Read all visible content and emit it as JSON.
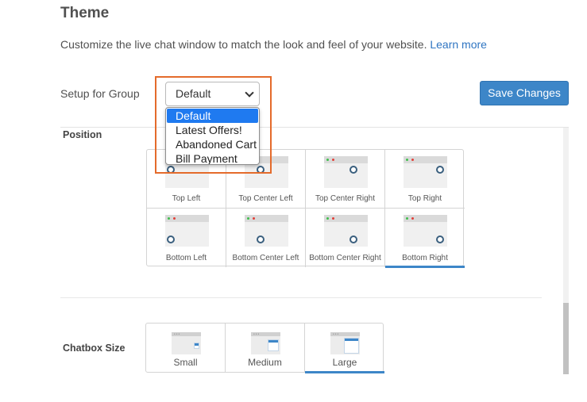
{
  "page": {
    "title": "Theme",
    "description": "Customize the live chat window to match the look and feel of your website.",
    "learn_more": "Learn more"
  },
  "setup": {
    "label": "Setup for Group",
    "selected": "Default",
    "options": [
      "Default",
      "Latest Offers!",
      "Abandoned Cart",
      "Bill Payment"
    ]
  },
  "toolbar": {
    "save_label": "Save Changes"
  },
  "position": {
    "label": "Position",
    "selected": "Bottom Right",
    "items": [
      "Top Left",
      "Top Center Left",
      "Top Center Right",
      "Top Right",
      "Bottom Left",
      "Bottom Center Left",
      "Bottom Center Right",
      "Bottom Right"
    ]
  },
  "chatbox_size": {
    "label": "Chatbox Size",
    "selected": "Large",
    "items": [
      "Small",
      "Medium",
      "Large"
    ]
  },
  "colors": {
    "accent": "#3d86c8",
    "highlight_border": "#e46b2b",
    "dropdown_selected": "#1f7af0",
    "link": "#2f75c2"
  },
  "icons": {
    "select_caret": "chevron-down-icon",
    "position_preview": "browser-window-icon",
    "chat_bubble": "chat-bubble-icon"
  }
}
